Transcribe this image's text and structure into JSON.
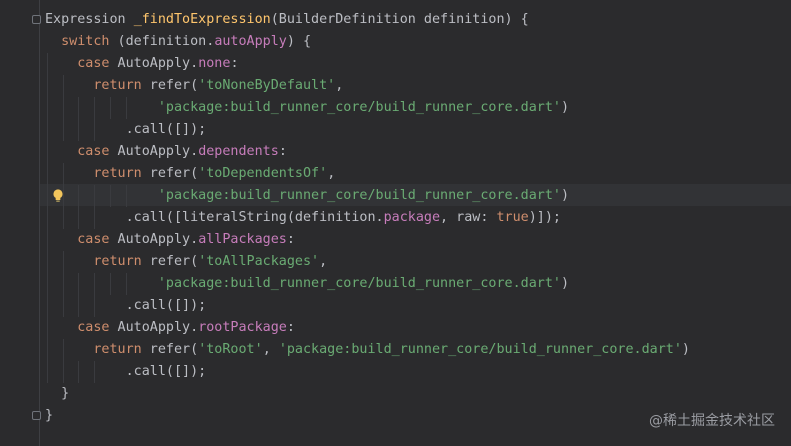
{
  "editor": {
    "lines": [
      [
        {
          "t": "Expression ",
          "c": "plain"
        },
        {
          "t": "_findToExpression",
          "c": "fn"
        },
        {
          "t": "(BuilderDefinition definition) {",
          "c": "plain"
        }
      ],
      [
        {
          "t": "  ",
          "c": "plain"
        },
        {
          "t": "switch",
          "c": "kw"
        },
        {
          "t": " (definition.",
          "c": "plain"
        },
        {
          "t": "autoApply",
          "c": "prop"
        },
        {
          "t": ") {",
          "c": "plain"
        }
      ],
      [
        {
          "t": "    ",
          "c": "plain"
        },
        {
          "t": "case",
          "c": "kw"
        },
        {
          "t": " AutoApply.",
          "c": "plain"
        },
        {
          "t": "none",
          "c": "prop"
        },
        {
          "t": ":",
          "c": "plain"
        }
      ],
      [
        {
          "t": "      ",
          "c": "plain"
        },
        {
          "t": "return",
          "c": "kw"
        },
        {
          "t": " refer(",
          "c": "plain"
        },
        {
          "t": "'toNoneByDefault'",
          "c": "str"
        },
        {
          "t": ",",
          "c": "plain"
        }
      ],
      [
        {
          "t": "              ",
          "c": "plain"
        },
        {
          "t": "'package:build_runner_core/build_runner_core.dart'",
          "c": "str"
        },
        {
          "t": ")",
          "c": "plain"
        }
      ],
      [
        {
          "t": "          .call([]);",
          "c": "plain"
        }
      ],
      [
        {
          "t": "    ",
          "c": "plain"
        },
        {
          "t": "case",
          "c": "kw"
        },
        {
          "t": " AutoApply.",
          "c": "plain"
        },
        {
          "t": "dependents",
          "c": "prop"
        },
        {
          "t": ":",
          "c": "plain"
        }
      ],
      [
        {
          "t": "      ",
          "c": "plain"
        },
        {
          "t": "return",
          "c": "kw"
        },
        {
          "t": " refer(",
          "c": "plain"
        },
        {
          "t": "'toDependentsOf'",
          "c": "str"
        },
        {
          "t": ",",
          "c": "plain"
        }
      ],
      [
        {
          "t": "              ",
          "c": "plain"
        },
        {
          "t": "'package:build_runner_core/build_runner_core.dart'",
          "c": "str"
        },
        {
          "t": ")",
          "c": "plain"
        }
      ],
      [
        {
          "t": "          .call([literalString(definition.",
          "c": "plain"
        },
        {
          "t": "package",
          "c": "prop"
        },
        {
          "t": ", raw: ",
          "c": "plain"
        },
        {
          "t": "true",
          "c": "kw"
        },
        {
          "t": ")]);",
          "c": "plain"
        }
      ],
      [
        {
          "t": "    ",
          "c": "plain"
        },
        {
          "t": "case",
          "c": "kw"
        },
        {
          "t": " AutoApply.",
          "c": "plain"
        },
        {
          "t": "allPackages",
          "c": "prop"
        },
        {
          "t": ":",
          "c": "plain"
        }
      ],
      [
        {
          "t": "      ",
          "c": "plain"
        },
        {
          "t": "return",
          "c": "kw"
        },
        {
          "t": " refer(",
          "c": "plain"
        },
        {
          "t": "'toAllPackages'",
          "c": "str"
        },
        {
          "t": ",",
          "c": "plain"
        }
      ],
      [
        {
          "t": "              ",
          "c": "plain"
        },
        {
          "t": "'package:build_runner_core/build_runner_core.dart'",
          "c": "str"
        },
        {
          "t": ")",
          "c": "plain"
        }
      ],
      [
        {
          "t": "          .call([]);",
          "c": "plain"
        }
      ],
      [
        {
          "t": "    ",
          "c": "plain"
        },
        {
          "t": "case",
          "c": "kw"
        },
        {
          "t": " AutoApply.",
          "c": "plain"
        },
        {
          "t": "rootPackage",
          "c": "prop"
        },
        {
          "t": ":",
          "c": "plain"
        }
      ],
      [
        {
          "t": "      ",
          "c": "plain"
        },
        {
          "t": "return",
          "c": "kw"
        },
        {
          "t": " refer(",
          "c": "plain"
        },
        {
          "t": "'toRoot'",
          "c": "str"
        },
        {
          "t": ", ",
          "c": "plain"
        },
        {
          "t": "'package:build_runner_core/build_runner_core.dart'",
          "c": "str"
        },
        {
          "t": ")",
          "c": "plain"
        }
      ],
      [
        {
          "t": "          .call([]);",
          "c": "plain"
        }
      ],
      [
        {
          "t": "  }",
          "c": "plain"
        }
      ],
      [
        {
          "t": "}",
          "c": "plain"
        }
      ]
    ],
    "bulb_line": 8,
    "fold_lines": [
      0,
      18
    ]
  },
  "colors": {
    "background": "#2b2b2d",
    "keyword": "#cf8e6d",
    "function": "#ffc66d",
    "property": "#c77dbb",
    "string": "#6aab73",
    "text": "#bcbec4",
    "bulb": "#f2c55c"
  },
  "icons": {
    "bulb": "intention-bulb-icon",
    "fold": "fold-marker-icon"
  },
  "watermark": "@稀土掘金技术社区"
}
